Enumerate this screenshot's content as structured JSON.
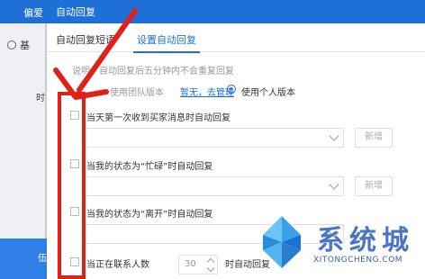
{
  "background": {
    "header_title": "偏爱",
    "sidebar_item": "基",
    "side_char": "时",
    "bottom_text": "伍"
  },
  "dialog": {
    "title": "自动回复",
    "tabs": [
      "自动回复短语",
      "设置自动回复"
    ],
    "note": "说明：自动回复后五分钟内不会重复回复",
    "version": {
      "team_label": "使用团队版本",
      "manage_link": "暂无，去管理",
      "personal_label": "使用个人版本"
    },
    "options": [
      "当天第一次收到买家消息时自动回复",
      "当我的状态为“忙碌”时自动回复",
      "当我的状态为“离开”时自动回复",
      "当正在联系人数"
    ],
    "new_button": "新增",
    "stepper_value": "30",
    "stepper_suffix": "时自动回复"
  },
  "watermark": {
    "text": "系统城",
    "url": "XITONGCHENG.COM"
  },
  "colors": {
    "accent": "#1e6fd6",
    "annotation": "#e0211a"
  }
}
